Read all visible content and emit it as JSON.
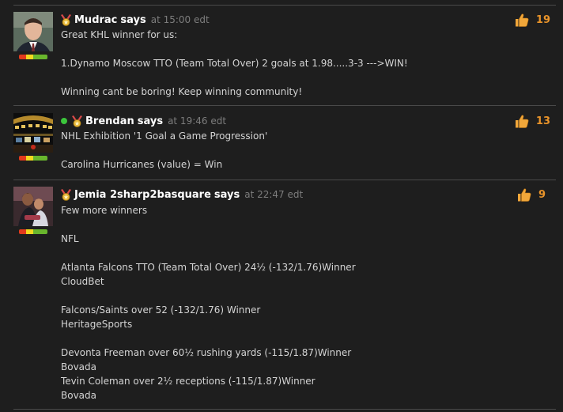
{
  "comments": [
    {
      "author": "Mudrac",
      "says": "says",
      "time": "at 15:00 edt",
      "online": false,
      "likes": "19",
      "lines": [
        "Great KHL winner for us:",
        "",
        "1.Dynamo Moscow TTO (Team Total Over) 2 goals at 1.98.....3-3 --->WIN!",
        "",
        "Winning cant be boring! Keep winning community!"
      ]
    },
    {
      "author": "Brendan",
      "says": "says",
      "time": "at 19:46 edt",
      "online": true,
      "likes": "13",
      "lines": [
        "NHL Exhibition '1 Goal a Game Progression'",
        "",
        "Carolina Hurricanes (value) = Win"
      ]
    },
    {
      "author": "Jemia 2sharp2basquare",
      "says": "says",
      "time": "at 22:47 edt",
      "online": false,
      "likes": "9",
      "lines": [
        "Few more winners",
        "",
        "NFL",
        "",
        "Atlanta Falcons TTO (Team Total Over) 24½ (-132/1.76)Winner",
        "CloudBet",
        "",
        "Falcons/Saints over 52 (-132/1.76) Winner",
        "HeritageSports",
        "",
        "Devonta Freeman over 60½ rushing yards (-115/1.87)Winner",
        "Bovada",
        "Tevin Coleman over 2½ receptions (-115/1.87)Winner",
        "Bovada"
      ]
    }
  ],
  "colors": {
    "background": "#1e1e1e",
    "like_count": "#e8932a",
    "time": "#7d7d7d",
    "divider": "#4a4a4a"
  }
}
